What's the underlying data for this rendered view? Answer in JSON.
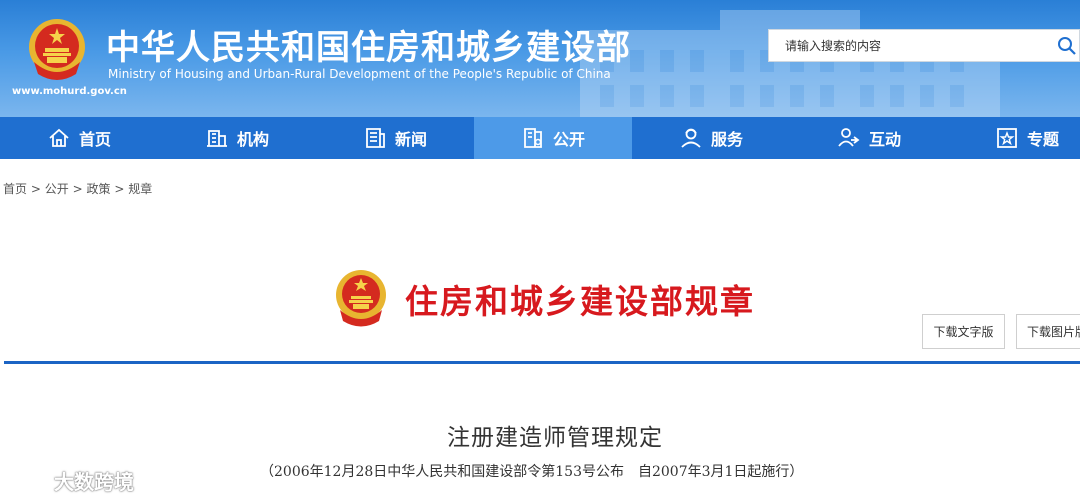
{
  "header": {
    "site_title": "中华人民共和国住房和城乡建设部",
    "site_subtitle": "Ministry of Housing and Urban-Rural Development of the People's Republic of China",
    "url": "www.mohurd.gov.cn",
    "search_placeholder": "请输入搜索的内容"
  },
  "nav": {
    "items": [
      {
        "label": "首页",
        "icon": "home-icon"
      },
      {
        "label": "机构",
        "icon": "building-icon"
      },
      {
        "label": "新闻",
        "icon": "news-icon"
      },
      {
        "label": "公开",
        "icon": "disclosure-icon",
        "active": true
      },
      {
        "label": "服务",
        "icon": "service-icon"
      },
      {
        "label": "互动",
        "icon": "interaction-icon"
      },
      {
        "label": "专题",
        "icon": "topic-icon"
      }
    ]
  },
  "breadcrumb": {
    "items": [
      "首页",
      "公开",
      "政策",
      "规章"
    ],
    "separator": ">"
  },
  "page": {
    "title": "住房和城乡建设部规章",
    "download_text": "下载文字版",
    "download_image": "下载图片版"
  },
  "document": {
    "title": "注册建造师管理规定",
    "meta": "（2006年12月28日中华人民共和国建设部令第153号公布　自2007年3月1日起施行）"
  },
  "watermark": {
    "text": "大数跨境"
  },
  "colors": {
    "header_blue": "#2a7fd6",
    "nav_blue": "#1f6fd0",
    "nav_active": "#4d9ae8",
    "title_red": "#d7191e",
    "divider_blue": "#1b64c4"
  }
}
